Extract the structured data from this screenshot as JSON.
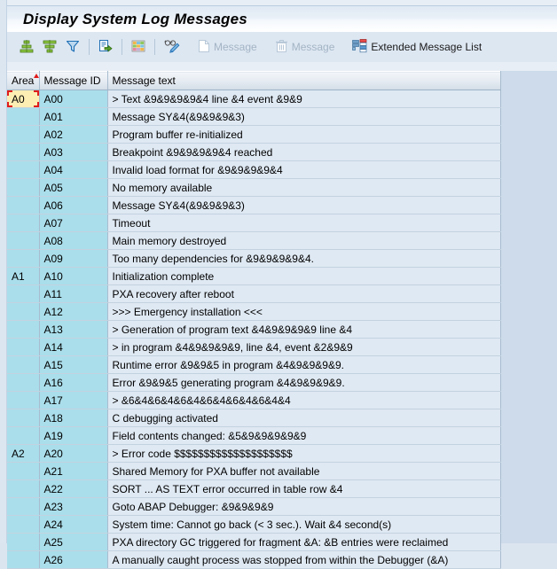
{
  "window": {
    "title": "Display System Log Messages"
  },
  "toolbar": {
    "buttons": [
      {
        "name": "sort-ascending-button",
        "icon": "sort-ascending-icon",
        "label": "",
        "enabled": true
      },
      {
        "name": "sort-descending-button",
        "icon": "sort-descending-icon",
        "label": "",
        "enabled": true
      },
      {
        "name": "filter-button",
        "icon": "filter-funnel-icon",
        "label": "",
        "enabled": true
      },
      {
        "name": "export-button",
        "icon": "export-document-icon",
        "label": "",
        "enabled": true
      },
      {
        "name": "layout-button",
        "icon": "layout-grid-icon",
        "label": "",
        "enabled": true
      },
      {
        "name": "display-change-button",
        "icon": "glasses-pencil-icon",
        "label": "",
        "enabled": true
      },
      {
        "name": "create-message-button",
        "icon": "document-page-icon",
        "label": "Message",
        "enabled": false
      },
      {
        "name": "delete-message-button",
        "icon": "trash-can-icon",
        "label": "Message",
        "enabled": false
      },
      {
        "name": "extended-message-list-button",
        "icon": "message-list-icon",
        "label": "Extended Message List",
        "enabled": true
      }
    ]
  },
  "grid": {
    "columns": [
      {
        "key": "area",
        "label": "Area",
        "sorted": "ascending"
      },
      {
        "key": "msgid",
        "label": "Message ID",
        "sorted": ""
      },
      {
        "key": "msgtxt",
        "label": "Message text",
        "sorted": ""
      }
    ],
    "selected_cell": {
      "row": 0,
      "column": "area"
    },
    "rows": [
      {
        "area": "A0",
        "msgid": "A00",
        "msgtxt": "> Text &9&9&9&9&4 line &4 event &9&9"
      },
      {
        "area": "",
        "msgid": "A01",
        "msgtxt": "Message SY&4(&9&9&9&3)"
      },
      {
        "area": "",
        "msgid": "A02",
        "msgtxt": "Program buffer re-initialized"
      },
      {
        "area": "",
        "msgid": "A03",
        "msgtxt": "Breakpoint &9&9&9&9&4 reached"
      },
      {
        "area": "",
        "msgid": "A04",
        "msgtxt": "Invalid load format for &9&9&9&9&4"
      },
      {
        "area": "",
        "msgid": "A05",
        "msgtxt": "No memory available"
      },
      {
        "area": "",
        "msgid": "A06",
        "msgtxt": "Message SY&4(&9&9&9&3)"
      },
      {
        "area": "",
        "msgid": "A07",
        "msgtxt": "Timeout"
      },
      {
        "area": "",
        "msgid": "A08",
        "msgtxt": "Main memory destroyed"
      },
      {
        "area": "",
        "msgid": "A09",
        "msgtxt": "Too many dependencies for &9&9&9&9&4."
      },
      {
        "area": "A1",
        "msgid": "A10",
        "msgtxt": "Initialization complete"
      },
      {
        "area": "",
        "msgid": "A11",
        "msgtxt": "PXA recovery after reboot"
      },
      {
        "area": "",
        "msgid": "A12",
        "msgtxt": ">>> Emergency installation <<<"
      },
      {
        "area": "",
        "msgid": "A13",
        "msgtxt": "> Generation of program text &4&9&9&9&9 line &4"
      },
      {
        "area": "",
        "msgid": "A14",
        "msgtxt": "> in program &4&9&9&9&9, line &4, event &2&9&9"
      },
      {
        "area": "",
        "msgid": "A15",
        "msgtxt": "Runtime error &9&9&5 in program &4&9&9&9&9."
      },
      {
        "area": "",
        "msgid": "A16",
        "msgtxt": "Error &9&9&5 generating program &4&9&9&9&9."
      },
      {
        "area": "",
        "msgid": "A17",
        "msgtxt": "> &6&4&6&4&6&4&6&4&6&4&6&4&4"
      },
      {
        "area": "",
        "msgid": "A18",
        "msgtxt": "C debugging activated"
      },
      {
        "area": "",
        "msgid": "A19",
        "msgtxt": "Field contents changed: &5&9&9&9&9&9"
      },
      {
        "area": "A2",
        "msgid": "A20",
        "msgtxt": "> Error code $$$$$$$$$$$$$$$$$$$$"
      },
      {
        "area": "",
        "msgid": "A21",
        "msgtxt": "Shared Memory for PXA buffer not available"
      },
      {
        "area": "",
        "msgid": "A22",
        "msgtxt": "SORT ... AS TEXT error occurred in table row &4"
      },
      {
        "area": "",
        "msgid": "A23",
        "msgtxt": "Goto ABAP Debugger: &9&9&9&9"
      },
      {
        "area": "",
        "msgid": "A24",
        "msgtxt": "System time: Cannot go back (< 3 sec.). Wait &4 second(s)"
      },
      {
        "area": "",
        "msgid": "A25",
        "msgtxt": "PXA directory GC triggered for fragment &A:  &B entries were reclaimed"
      },
      {
        "area": "",
        "msgid": "A26",
        "msgtxt": "A manually caught process was stopped from within the Debugger (&A)"
      }
    ]
  },
  "colors": {
    "title_bar_bg": "#e9f0f7",
    "toolbar_bg": "#dde7f2",
    "grid_bg": "#cddbea",
    "key_column_bg": "#aadeeb",
    "data_column_bg": "#dfe9f3",
    "selection_bg": "#fdeeb3",
    "selection_border": "#e01b1b",
    "icon_green": "#6cb33f",
    "icon_blue": "#1f6fb4"
  }
}
